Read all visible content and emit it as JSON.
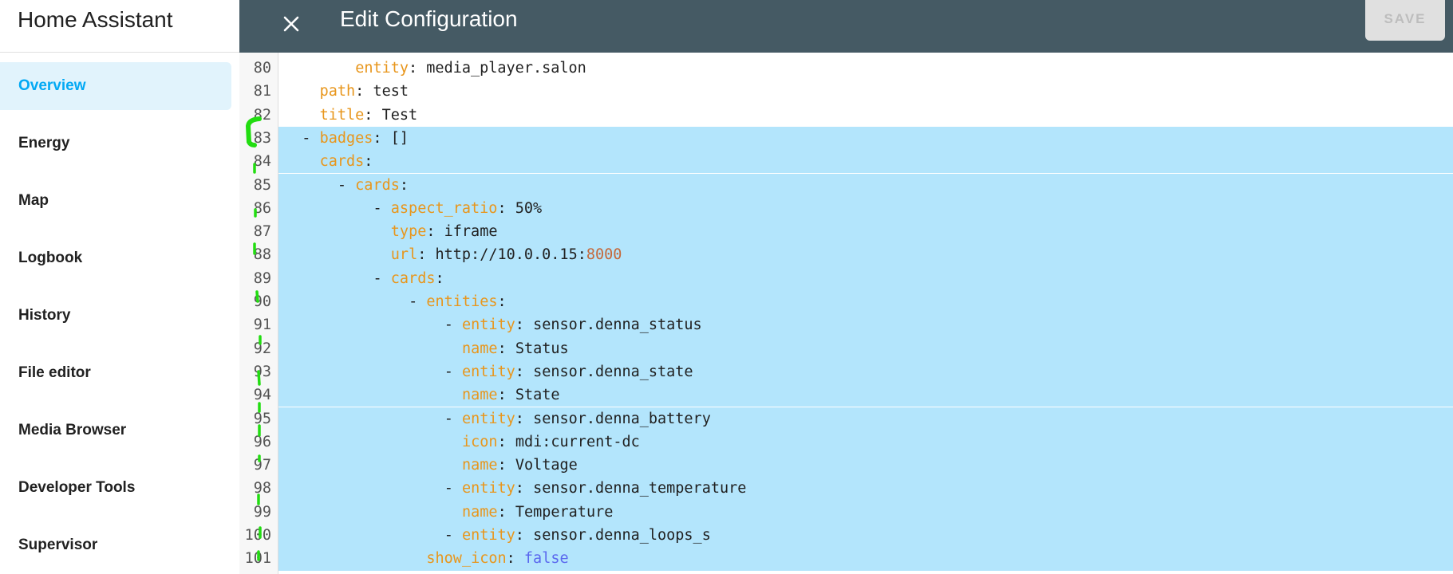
{
  "sidebar": {
    "title": "Home Assistant",
    "items": [
      {
        "label": "Overview",
        "active": true
      },
      {
        "label": "Energy"
      },
      {
        "label": "Map"
      },
      {
        "label": "Logbook"
      },
      {
        "label": "History"
      },
      {
        "label": "File editor"
      },
      {
        "label": "Media Browser"
      },
      {
        "label": "Developer Tools"
      },
      {
        "label": "Supervisor"
      }
    ]
  },
  "header": {
    "close_icon": "close-icon",
    "title": "Edit Configuration",
    "save_label": "SAVE"
  },
  "colors": {
    "header": "#455a64",
    "accent": "#03a9f4",
    "selection": "#b3e5fc",
    "key": "#e8961c",
    "annotation": "#22dd11"
  },
  "editor": {
    "lines": [
      {
        "n": "80",
        "indent": 8,
        "dash": "",
        "key": "entity",
        "value": "media_player.salon",
        "sel": false
      },
      {
        "n": "81",
        "indent": 4,
        "dash": "",
        "key": "path",
        "value": "test",
        "sel": false
      },
      {
        "n": "82",
        "indent": 4,
        "dash": "",
        "key": "title",
        "value": "Test",
        "sel": false
      },
      {
        "n": "83",
        "indent": 2,
        "dash": "- ",
        "key": "badges",
        "value": "[]",
        "sel": true
      },
      {
        "n": "84",
        "indent": 4,
        "dash": "",
        "key": "cards",
        "value": "",
        "sel": true
      },
      {
        "n": "85",
        "indent": 6,
        "dash": "- ",
        "key": "cards",
        "value": "",
        "sel": true
      },
      {
        "n": "86",
        "indent": 10,
        "dash": "- ",
        "key": "aspect_ratio",
        "value": "50%",
        "sel": true
      },
      {
        "n": "87",
        "indent": 12,
        "dash": "",
        "key": "type",
        "value": "iframe",
        "sel": true
      },
      {
        "n": "88",
        "indent": 12,
        "dash": "",
        "key": "url",
        "value": "http://10.0.0.15:",
        "num": "8000",
        "sel": true
      },
      {
        "n": "89",
        "indent": 10,
        "dash": "- ",
        "key": "cards",
        "value": "",
        "sel": true
      },
      {
        "n": "90",
        "indent": 14,
        "dash": "- ",
        "key": "entities",
        "value": "",
        "sel": true
      },
      {
        "n": "91",
        "indent": 18,
        "dash": "- ",
        "key": "entity",
        "value": "sensor.denna_status",
        "sel": true
      },
      {
        "n": "92",
        "indent": 20,
        "dash": "",
        "key": "name",
        "value": "Status",
        "sel": true
      },
      {
        "n": "93",
        "indent": 18,
        "dash": "- ",
        "key": "entity",
        "value": "sensor.denna_state",
        "sel": true
      },
      {
        "n": "94",
        "indent": 20,
        "dash": "",
        "key": "name",
        "value": "State",
        "sel": true
      },
      {
        "n": "95",
        "indent": 18,
        "dash": "- ",
        "key": "entity",
        "value": "sensor.denna_battery",
        "sel": true
      },
      {
        "n": "96",
        "indent": 20,
        "dash": "",
        "key": "icon",
        "value": "mdi:current-dc",
        "sel": true
      },
      {
        "n": "97",
        "indent": 20,
        "dash": "",
        "key": "name",
        "value": "Voltage",
        "sel": true
      },
      {
        "n": "98",
        "indent": 18,
        "dash": "- ",
        "key": "entity",
        "value": "sensor.denna_temperature",
        "sel": true
      },
      {
        "n": "99",
        "indent": 20,
        "dash": "",
        "key": "name",
        "value": "Temperature",
        "sel": true
      },
      {
        "n": "100",
        "indent": 18,
        "dash": "- ",
        "key": "entity",
        "value": "sensor.denna_loops_s",
        "sel": true
      },
      {
        "n": "101",
        "indent": 16,
        "dash": "",
        "key": "show_icon",
        "bool": "false",
        "value": "",
        "sel": true
      }
    ]
  }
}
